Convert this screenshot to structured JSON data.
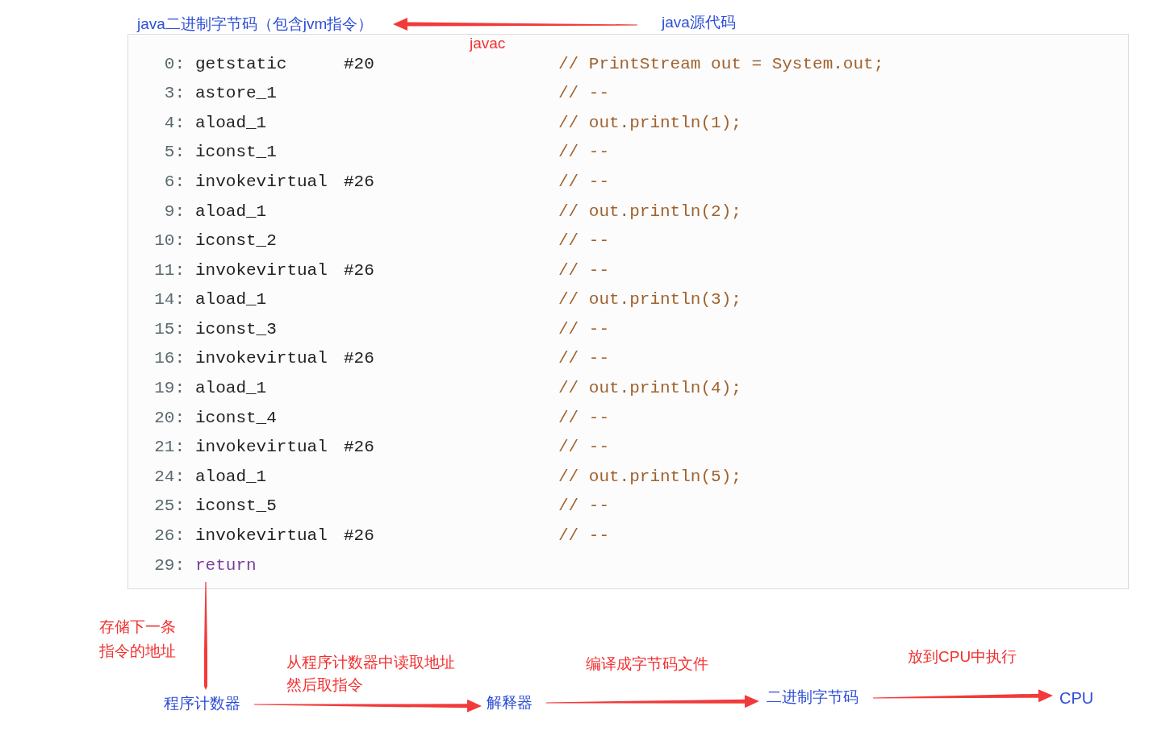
{
  "code_lines": [
    {
      "offset": "0:",
      "instruction": "getstatic",
      "operand": "#20",
      "comment": "// PrintStream out = System.out;",
      "kind": "op"
    },
    {
      "offset": "3:",
      "instruction": "astore_1",
      "comment": "// --",
      "kind": "op"
    },
    {
      "offset": "4:",
      "instruction": "aload_1",
      "comment": "// out.println(1);",
      "kind": "op"
    },
    {
      "offset": "5:",
      "instruction": "iconst_1",
      "comment": "// --",
      "kind": "op"
    },
    {
      "offset": "6:",
      "instruction": "invokevirtual",
      "operand": "#26",
      "comment": "// --",
      "kind": "op"
    },
    {
      "offset": "9:",
      "instruction": "aload_1",
      "comment": "// out.println(2);",
      "kind": "op"
    },
    {
      "offset": "10:",
      "instruction": "iconst_2",
      "comment": "// --",
      "kind": "op"
    },
    {
      "offset": "11:",
      "instruction": "invokevirtual",
      "operand": "#26",
      "comment": "// --",
      "kind": "op"
    },
    {
      "offset": "14:",
      "instruction": "aload_1",
      "comment": "// out.println(3);",
      "kind": "op"
    },
    {
      "offset": "15:",
      "instruction": "iconst_3",
      "comment": "// --",
      "kind": "op"
    },
    {
      "offset": "16:",
      "instruction": "invokevirtual",
      "operand": "#26",
      "comment": "// --",
      "kind": "op"
    },
    {
      "offset": "19:",
      "instruction": "aload_1",
      "comment": "// out.println(4);",
      "kind": "op"
    },
    {
      "offset": "20:",
      "instruction": "iconst_4",
      "comment": "// --",
      "kind": "op"
    },
    {
      "offset": "21:",
      "instruction": "invokevirtual",
      "operand": "#26",
      "comment": "// --",
      "kind": "op"
    },
    {
      "offset": "24:",
      "instruction": "aload_1",
      "comment": "// out.println(5);",
      "kind": "op"
    },
    {
      "offset": "25:",
      "instruction": "iconst_5",
      "comment": "// --",
      "kind": "op"
    },
    {
      "offset": "26:",
      "instruction": "invokevirtual",
      "operand": "#26",
      "comment": "// --",
      "kind": "op"
    },
    {
      "offset": "29:",
      "instruction": "return",
      "kind": "keyword"
    }
  ],
  "annotations": {
    "bytecode_label": "java二进制字节码（包含jvm指令）",
    "source_label": "java源代码",
    "javac_label": "javac",
    "pc_note": [
      "存储下一条",
      "指令的地址"
    ],
    "program_counter": "程序计数器",
    "read_note": [
      "从程序计数器中读取地址",
      "然后取指令"
    ],
    "interpreter": "解释器",
    "compile_note": "编译成字节码文件",
    "binary_bytecode": "二进制字节码",
    "execute_note": "放到CPU中执行",
    "cpu": "CPU"
  }
}
